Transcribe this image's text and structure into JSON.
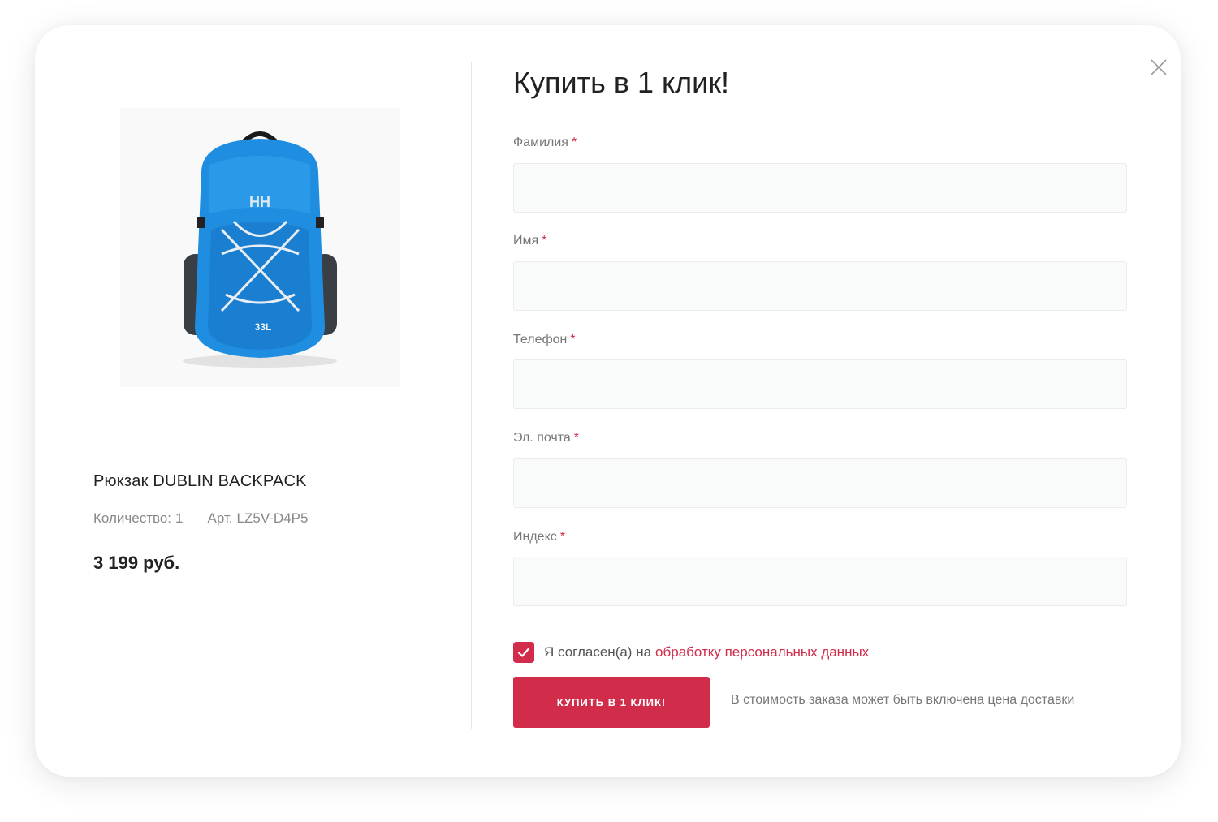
{
  "title": "Купить в 1 клик!",
  "close_icon": "close-icon",
  "product": {
    "name": "Рюкзак DUBLIN BACKPACK",
    "quantity_label": "Количество:",
    "quantity_value": "1",
    "article_label": "Арт.",
    "article_value": "LZ5V-D4P5",
    "price": "3 199 руб.",
    "image": {
      "subject": "backpack",
      "color": "#1f8ee0",
      "brand_mark": "HH",
      "volume_mark": "33L"
    }
  },
  "form": {
    "fields": [
      {
        "label": "Фамилия",
        "required_mark": "*",
        "value": "",
        "placeholder": ""
      },
      {
        "label": "Имя",
        "required_mark": "*",
        "value": "",
        "placeholder": ""
      },
      {
        "label": "Телефон",
        "required_mark": "*",
        "value": "",
        "placeholder": ""
      },
      {
        "label": "Эл. почта",
        "required_mark": "*",
        "value": "",
        "placeholder": ""
      },
      {
        "label": "Индекс",
        "required_mark": "*",
        "value": "",
        "placeholder": ""
      }
    ],
    "consent": {
      "checked": true,
      "text": "Я согласен(а) на",
      "link_text": "обработку персональных данных"
    },
    "submit_label": "купить в 1 клик!",
    "note": "В стоимость заказа может быть включена цена доставки"
  },
  "colors": {
    "accent": "#d12c4a",
    "input_bg": "#f9fafa",
    "label": "#777777",
    "text_dark": "#222222"
  }
}
